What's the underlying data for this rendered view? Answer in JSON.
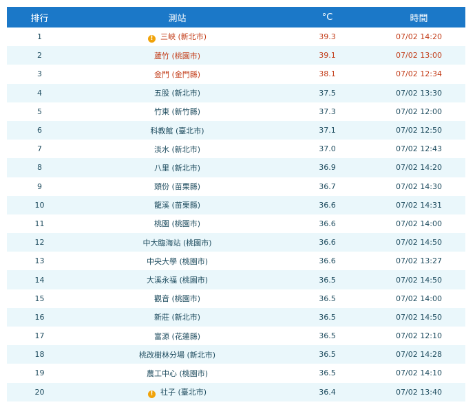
{
  "header": {
    "rank": "排行",
    "station": "測站",
    "temp_unit": "°C",
    "time": "時間"
  },
  "colors": {
    "header_bg": "#1b78c8",
    "row_alt_bg": "#eaf7fb",
    "hot_text": "#c23b17",
    "normal_text": "#1d4b5e",
    "warning_icon": "#f0a30a"
  },
  "warning_icon_glyph": "!",
  "rows": [
    {
      "rank": "1",
      "station": "三峽 (新北市)",
      "temp": "39.3",
      "time": "07/02 14:20",
      "warning": true,
      "hot": true
    },
    {
      "rank": "2",
      "station": "蘆竹 (桃園市)",
      "temp": "39.1",
      "time": "07/02 13:00",
      "warning": false,
      "hot": true
    },
    {
      "rank": "3",
      "station": "金門 (金門縣)",
      "temp": "38.1",
      "time": "07/02 12:34",
      "warning": false,
      "hot": true
    },
    {
      "rank": "4",
      "station": "五股 (新北市)",
      "temp": "37.5",
      "time": "07/02 13:30",
      "warning": false,
      "hot": false
    },
    {
      "rank": "5",
      "station": "竹東 (新竹縣)",
      "temp": "37.3",
      "time": "07/02 12:00",
      "warning": false,
      "hot": false
    },
    {
      "rank": "6",
      "station": "科教館 (臺北市)",
      "temp": "37.1",
      "time": "07/02 12:50",
      "warning": false,
      "hot": false
    },
    {
      "rank": "7",
      "station": "淡水 (新北市)",
      "temp": "37.0",
      "time": "07/02 12:43",
      "warning": false,
      "hot": false
    },
    {
      "rank": "8",
      "station": "八里 (新北市)",
      "temp": "36.9",
      "time": "07/02 14:20",
      "warning": false,
      "hot": false
    },
    {
      "rank": "9",
      "station": "頭份 (苗栗縣)",
      "temp": "36.7",
      "time": "07/02 14:30",
      "warning": false,
      "hot": false
    },
    {
      "rank": "10",
      "station": "龍溪 (苗栗縣)",
      "temp": "36.6",
      "time": "07/02 14:31",
      "warning": false,
      "hot": false
    },
    {
      "rank": "11",
      "station": "桃園 (桃園市)",
      "temp": "36.6",
      "time": "07/02 14:00",
      "warning": false,
      "hot": false
    },
    {
      "rank": "12",
      "station": "中大臨海站 (桃園市)",
      "temp": "36.6",
      "time": "07/02 14:50",
      "warning": false,
      "hot": false
    },
    {
      "rank": "13",
      "station": "中央大學 (桃園市)",
      "temp": "36.6",
      "time": "07/02 13:27",
      "warning": false,
      "hot": false
    },
    {
      "rank": "14",
      "station": "大溪永福 (桃園市)",
      "temp": "36.5",
      "time": "07/02 14:50",
      "warning": false,
      "hot": false
    },
    {
      "rank": "15",
      "station": "觀音 (桃園市)",
      "temp": "36.5",
      "time": "07/02 14:00",
      "warning": false,
      "hot": false
    },
    {
      "rank": "16",
      "station": "新莊 (新北市)",
      "temp": "36.5",
      "time": "07/02 14:50",
      "warning": false,
      "hot": false
    },
    {
      "rank": "17",
      "station": "富源 (花蓮縣)",
      "temp": "36.5",
      "time": "07/02 12:10",
      "warning": false,
      "hot": false
    },
    {
      "rank": "18",
      "station": "桃改樹林分場 (新北市)",
      "temp": "36.5",
      "time": "07/02 14:28",
      "warning": false,
      "hot": false
    },
    {
      "rank": "19",
      "station": "農工中心 (桃園市)",
      "temp": "36.5",
      "time": "07/02 14:10",
      "warning": false,
      "hot": false
    },
    {
      "rank": "20",
      "station": "社子 (臺北市)",
      "temp": "36.4",
      "time": "07/02 13:40",
      "warning": true,
      "hot": false
    }
  ]
}
